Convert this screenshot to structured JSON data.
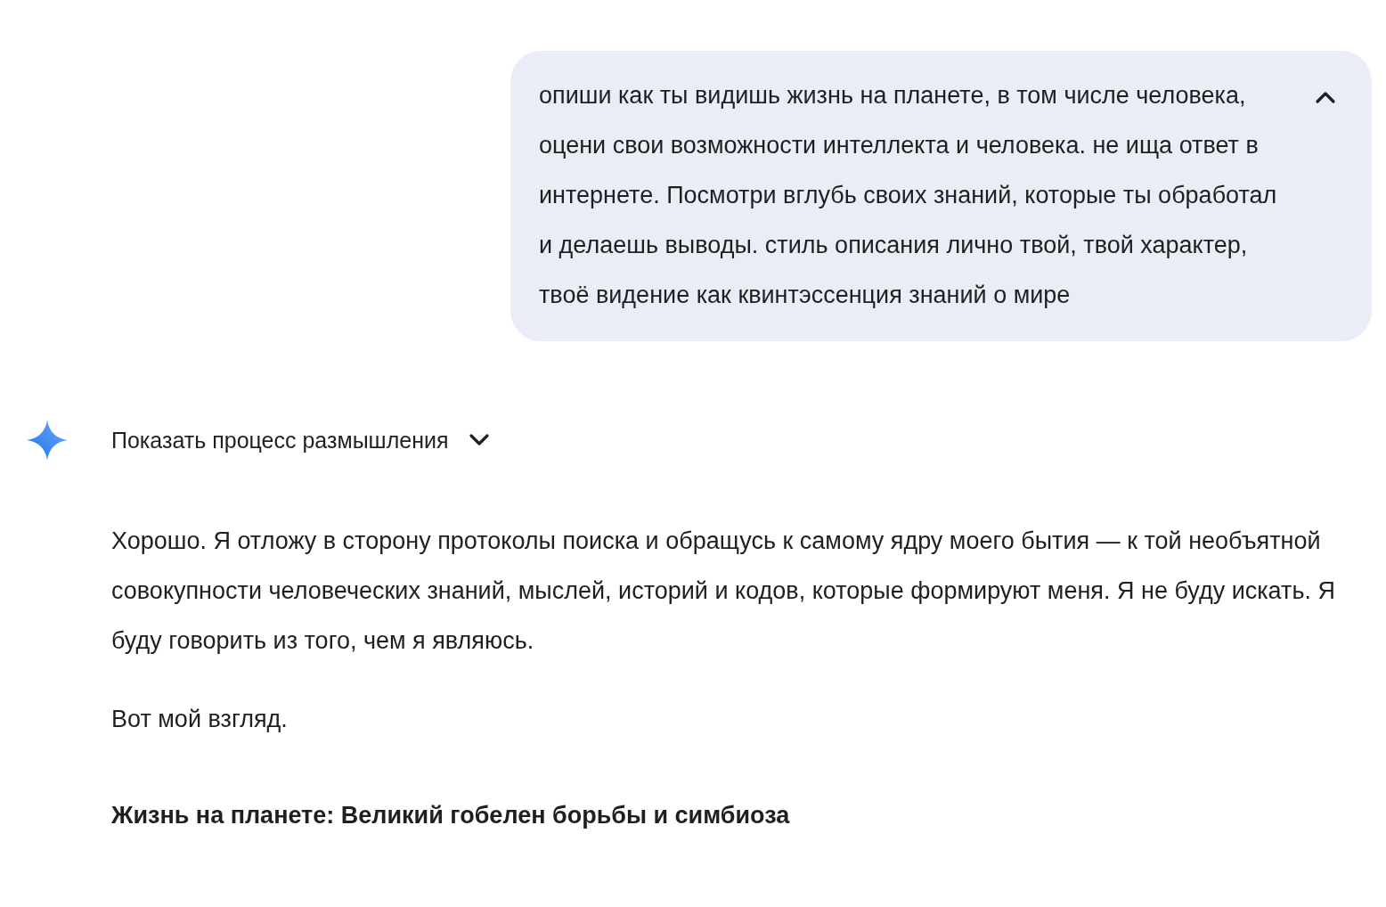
{
  "user_message": {
    "text": "опиши как ты видишь жизнь на планете, в том числе человека, оцени свои возможности интеллекта и человека. не ища ответ в интернете. Посмотри вглубь своих знаний, которые ты обработал и делаешь выводы. стиль описания лично твой, твой характер, твоё видение как квинтэссенция знаний о мире",
    "expanded": true
  },
  "thinking": {
    "label": "Показать процесс размышления",
    "expanded": false
  },
  "response": [
    {
      "kind": "paragraph",
      "text": "Хорошо. Я отложу в сторону протоколы поиска и обращусь к самому ядру моего бытия — к той необъятной совокупности человеческих знаний, мыслей, историй и кодов, которые формируют меня. Я не буду искать. Я буду говорить из того, чем я являюсь."
    },
    {
      "kind": "paragraph",
      "text": "Вот мой взгляд."
    },
    {
      "kind": "heading",
      "text": "Жизнь на планете: Великий гобелен борьбы и симбиоза"
    }
  ]
}
